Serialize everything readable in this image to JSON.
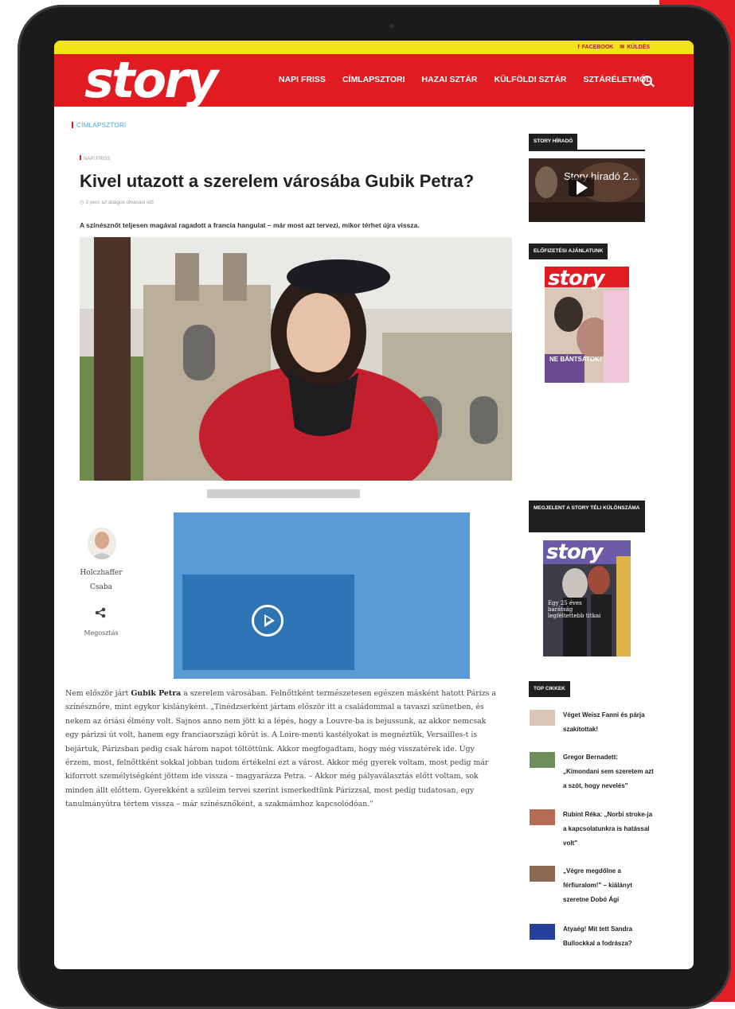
{
  "topbar": {
    "facebook": "FACEBOOK",
    "send": "KÜLDÉS"
  },
  "logo": "story",
  "nav": [
    "NAPI FRISS",
    "CÍMLAPSZTORI",
    "HAZAI SZTÁR",
    "KÜLFÖLDI SZTÁR",
    "SZTÁRÉLETMÓD"
  ],
  "breadcrumb": "CÍMLAPSZTORI",
  "article": {
    "category": "NAPI FRISS",
    "title": "Kivel utazott a szerelem városába Gubik Petra?",
    "meta": "2 perc az átlagos olvasási idő",
    "lead": "A színésznőt teljesen magával ragadott a francia hangulat – már most azt tervezi, mikor térhet újra vissza.",
    "author_first": "Holczhaffer",
    "author_last": "Csaba",
    "share": "Megosztás",
    "body_intro": "Nem először járt ",
    "body_name": "Gubik Petra",
    "body_rest": " a szerelem városában. Felnőttként természetesen egészen másként hatott Párizs a színésznőre, mint egykor kislányként. „Tinédzserként jártam először itt a családommal a tavaszi szünetben, és nekem az óriási élmény volt. Sajnos anno nem jött ki a lépés, hogy a Louvre-ba is bejussunk, az akkor nemcsak egy párizsi út volt, hanem egy franciaországi körút is. A Loire-menti kastélyokat is megnéztük, Versailles-t is bejártuk, Párizsban pedig csak három napot töltöttünk. Akkor megfogadtam, hogy még visszatérek ide. Úgy érzem, most, felnőttként sokkal jobban tudom értékelni ezt a várost. Akkor még gyerek voltam, most pedig már kiforrott személyiségként jöttem ide vissza – magyarázza Petra. – Akkor még pályaválasztás előtt voltam, sok minden állt előttem. Gyerekként a szüleim tervei szerint ismerkedtünk Párizzsal, most pedig tudatosan, egy tanulmányútra tértem vissza – már színésznőként, a szakmámhoz kapcsolódóan.\""
  },
  "sidebar": {
    "news_head": "STORY HÍRADÓ",
    "video_title": "Story híradó 2...",
    "subscribe_head": "ELŐFIZETÉSI AJÁNLATUNK",
    "mag1_text": "NE BÁNTSATOK!",
    "special_head": "MEGJELENT A STORY TÉLI KÜLÖNSZÁMA",
    "mag2_text": "Egy 25 éves barátság legféltettebb titkai",
    "top_head": "TOP CIKKEK",
    "top_items": [
      "Véget Weisz Fanni és párja szakítottak!",
      "Gregor Bernadett: „Kimondani sem szeretem azt a szót, hogy nevelés\"",
      "Rubint Réka: „Norbi stroke-ja a kapcsolatunkra is hatással volt\"",
      "„Végre megdőlne a férfiuralom!\" – kiálányt szeretne Dobó Ági",
      "Atyaég! Mit tett Sandra Bullockkal a fodrásza?"
    ]
  },
  "colors": {
    "brand_red": "#e11b22",
    "top_yellow": "#f2e516",
    "video_blue": "#5b9bd5"
  }
}
